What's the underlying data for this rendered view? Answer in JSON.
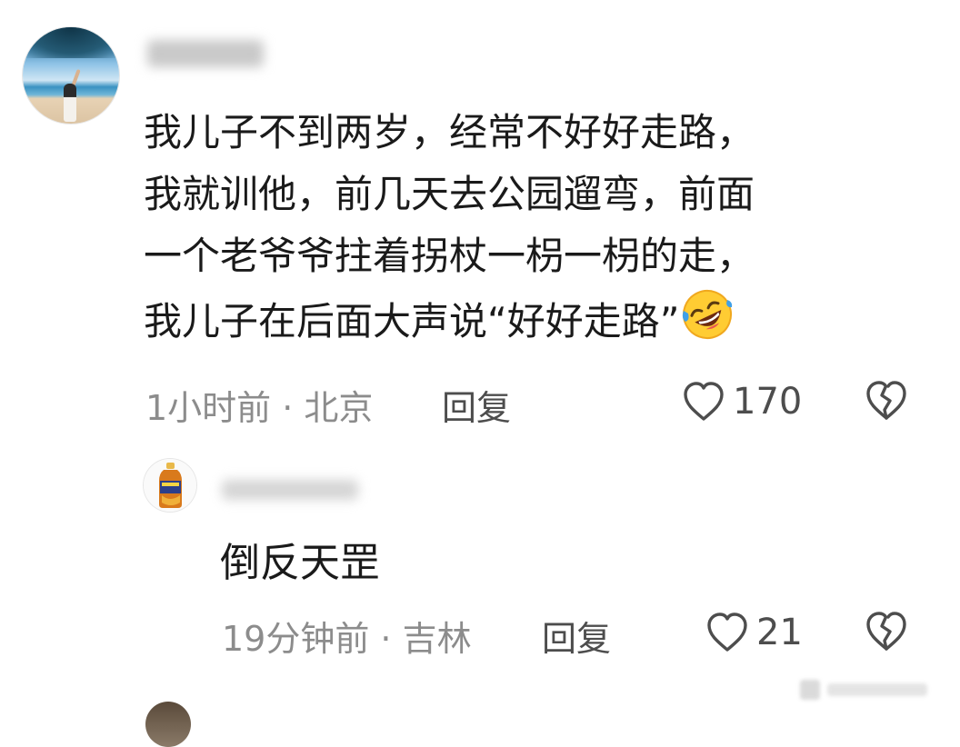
{
  "comment1": {
    "lines": [
      "我儿子不到两岁，经常不好好走路，",
      "我就训他，前几天去公园遛弯，前面",
      "一个老爷爷拄着拐杖一枴一枴的走，",
      "我儿子在后面大声说“好好走路”"
    ],
    "emoji": "rofl-emoji",
    "meta": "1小时前 · 北京",
    "reply_label": "回复",
    "likes": "170"
  },
  "reply1": {
    "text": "倒反天罡",
    "meta": "19分钟前 · 吉林",
    "reply_label": "回复",
    "likes": "21"
  },
  "icons": {
    "like": "heart-outline-icon",
    "dislike": "broken-heart-icon"
  },
  "colors": {
    "text": "#1a1a1a",
    "meta": "#8c8c8c",
    "action": "#4d4d4d"
  }
}
